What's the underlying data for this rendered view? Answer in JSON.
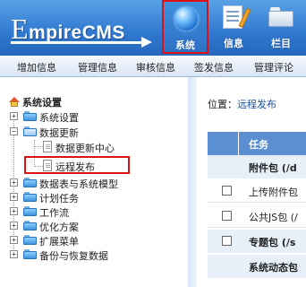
{
  "header": {
    "logo_first": "E",
    "logo_rest": "mpireCMS",
    "nav": [
      {
        "label": "系统",
        "icon": "globe-icon",
        "active": true
      },
      {
        "label": "信息",
        "icon": "document-edit-icon",
        "active": false
      },
      {
        "label": "栏目",
        "icon": "folder-icon",
        "active": false
      }
    ]
  },
  "submenu": [
    "增加信息",
    "管理信息",
    "审核信息",
    "签发信息",
    "管理评论"
  ],
  "tree": {
    "root": "系统设置",
    "nodes": [
      {
        "label": "系统设置",
        "expanded": false
      },
      {
        "label": "数据更新",
        "expanded": true
      },
      {
        "label": "数据更新中心",
        "leaf": true
      },
      {
        "label": "远程发布",
        "leaf": true,
        "highlighted": true
      },
      {
        "label": "数据表与系统模型",
        "expanded": false
      },
      {
        "label": "计划任务",
        "expanded": false
      },
      {
        "label": "工作流",
        "expanded": false
      },
      {
        "label": "优化方案",
        "expanded": false
      },
      {
        "label": "扩展菜单",
        "expanded": false
      },
      {
        "label": "备份与恢复数据",
        "expanded": false
      }
    ]
  },
  "content": {
    "location_label": "位置：",
    "location_link": "远程发布",
    "table": {
      "header": "任务",
      "rows": [
        {
          "type": "group",
          "text": "附件包 (/d"
        },
        {
          "type": "item",
          "text": "上传附件包"
        },
        {
          "type": "item",
          "text": "公共JS包 (/"
        },
        {
          "type": "group",
          "text": "专题包 (/s"
        },
        {
          "type": "group",
          "text": "系统动态包"
        }
      ]
    }
  },
  "colors": {
    "header_blue": "#2f78cf",
    "highlight_red": "#dd1111",
    "table_head": "#5c8fd1"
  }
}
